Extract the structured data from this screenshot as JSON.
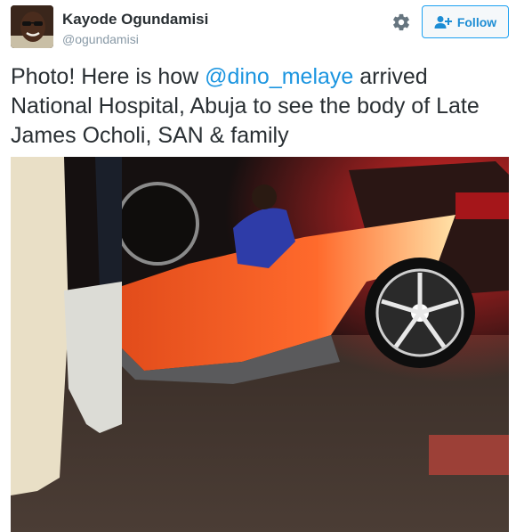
{
  "user": {
    "name": "Kayode Ogundamisi",
    "handle": "@ogundamisi",
    "avatar_icon": "profile-photo"
  },
  "actions": {
    "settings_icon": "gear-icon",
    "follow_label": "Follow",
    "follow_icon": "add-user-icon"
  },
  "tweet": {
    "text_before": "Photo! Here is how ",
    "mention": "@dino_melaye",
    "text_after": " arrived National Hospital, Abuja to see the body of Late James Ocholi, SAN & family"
  },
  "media": {
    "type": "photo"
  },
  "colors": {
    "accent": "#1da1f2",
    "mention": "#1b95e0",
    "text": "#292f33",
    "muted": "#8899a6"
  }
}
